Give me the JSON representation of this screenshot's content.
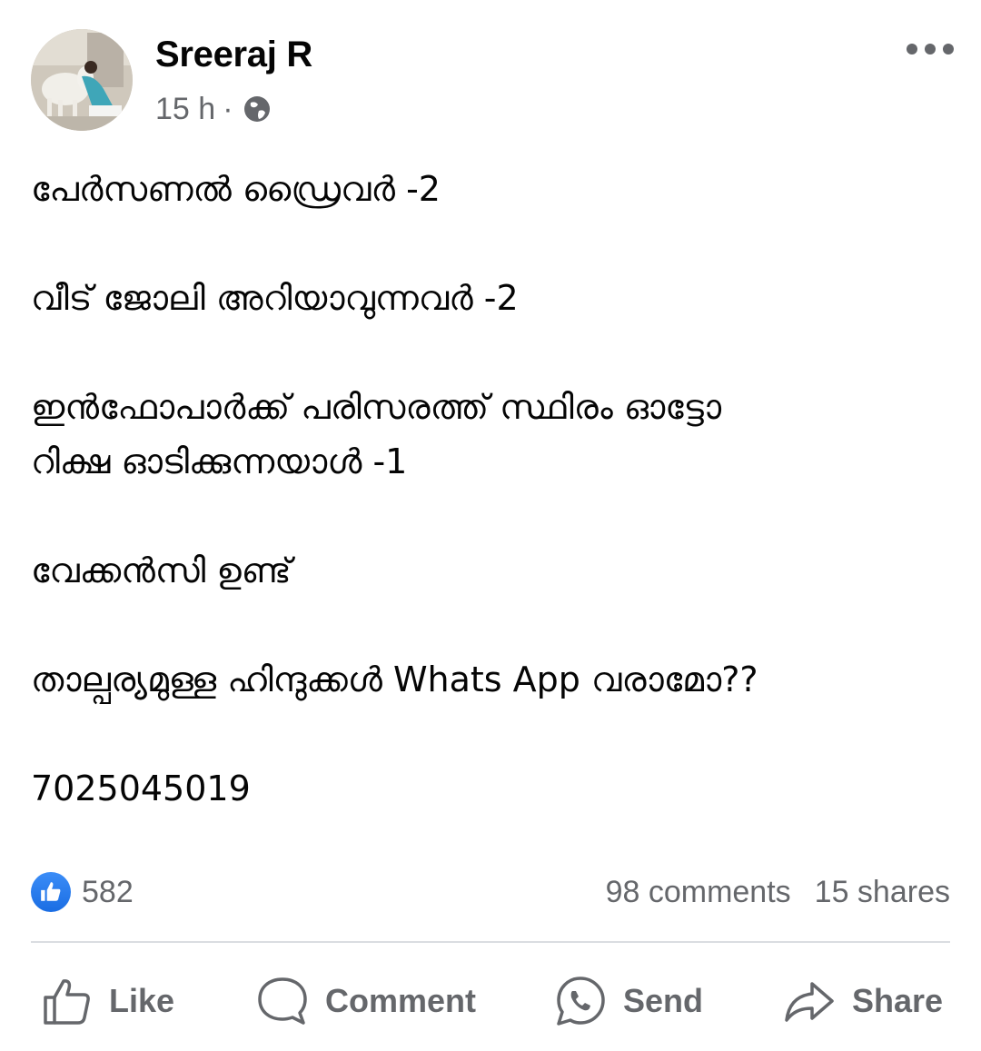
{
  "post": {
    "author": "Sreeraj R",
    "time": "15 h",
    "separator": "·",
    "privacy_icon": "globe-icon",
    "paragraphs": [
      [
        "പേർസണൽ ഡ്രൈവർ -2"
      ],
      [
        "വീട് ജോലി അറിയാവുന്നവർ -2"
      ],
      [
        "ഇൻഫോപാർക്ക് പരിസരത്ത് സ്ഥിരം ഓട്ടോ",
        "റിക്ഷ ഓടിക്കുന്നയാൾ -1"
      ],
      [
        "വേക്കൻസി ഉണ്ട്"
      ],
      [
        "താല്പര്യമുള്ള ഹിന്ദുക്കൾ Whats App വരാമോ??"
      ],
      [
        "7025045019"
      ]
    ]
  },
  "stats": {
    "reactions": "582",
    "comments": "98 comments",
    "shares": "15 shares"
  },
  "actions": {
    "like": "Like",
    "comment": "Comment",
    "send": "Send",
    "share": "Share"
  },
  "colors": {
    "text": "#050505",
    "secondary": "#65676b",
    "like_blue": "#1877f2",
    "divider": "#dadde1"
  }
}
